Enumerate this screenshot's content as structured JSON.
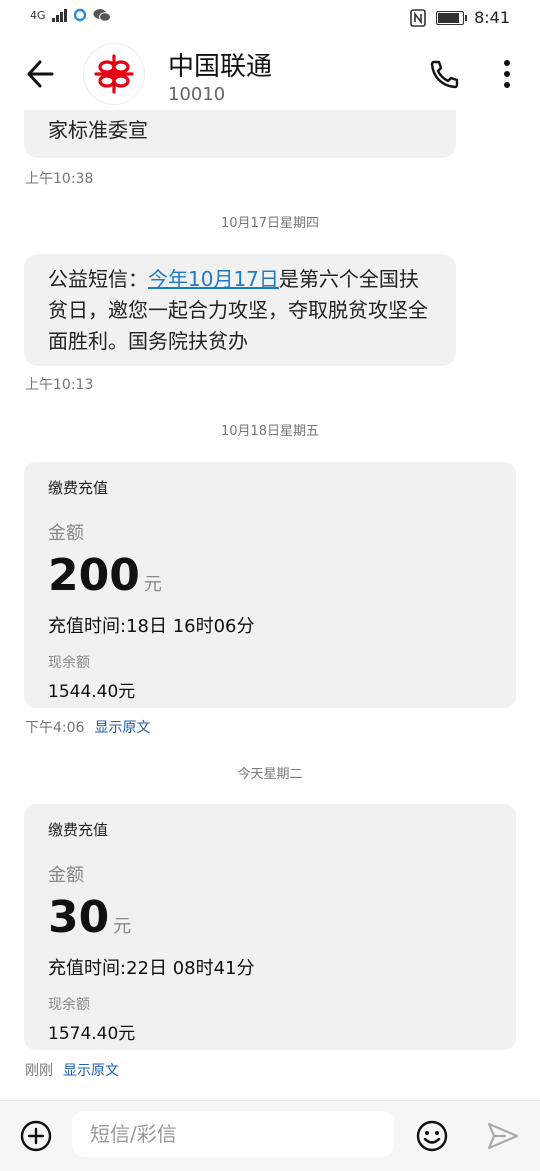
{
  "status_bar": {
    "network": "4G",
    "time": "8:41"
  },
  "header": {
    "contact_name": "中国联通",
    "contact_number": "10010"
  },
  "messages": [
    {
      "text": "相贫易，节省人民生活。市场监督总局、国家标准委宣",
      "time": "上午10:38"
    },
    {
      "date": "10月17日星期四"
    },
    {
      "prefix": "公益短信：",
      "link": "今年10月17日",
      "suffix": "是第六个全国扶贫日，邀您一起合力攻坚，夺取脱贫攻坚全面胜利。国务院扶贫办",
      "time": "上午10:13"
    },
    {
      "date": "10月18日星期五"
    },
    {
      "card": {
        "title": "缴费充值",
        "amount_label": "金额",
        "amount": "200",
        "unit": "元",
        "recharge_time": "充值时间:18日 16时06分",
        "balance_label": "现余额",
        "balance": "1544.40元"
      },
      "time": "下午4:06",
      "show_original": "显示原文"
    },
    {
      "date": "今天星期二"
    },
    {
      "card": {
        "title": "缴费充值",
        "amount_label": "金额",
        "amount": "30",
        "unit": "元",
        "recharge_time": "充值时间:22日 08时41分",
        "balance_label": "现余额",
        "balance": "1574.40元"
      },
      "time": "刚刚",
      "show_original": "显示原文"
    }
  ],
  "input": {
    "placeholder": "短信/彩信"
  },
  "icons": {
    "back": "arrow-left-icon",
    "call": "phone-icon",
    "more": "more-vertical-icon",
    "add": "plus-circle-icon",
    "emoji": "emoji-icon",
    "send": "send-icon"
  },
  "colors": {
    "link": "#1e7ac8",
    "bubble": "#f1f1f1",
    "logo_red": "#e60012"
  }
}
